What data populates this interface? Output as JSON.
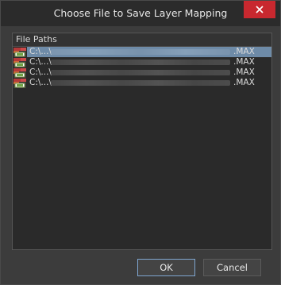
{
  "window": {
    "title": "Choose File to Save Layer Mapping"
  },
  "table": {
    "column_header": "File Paths",
    "rows": [
      {
        "prefix": "C:\\...\\",
        "ext": ".MAX",
        "selected": true
      },
      {
        "prefix": "C:\\...\\",
        "ext": ".MAX",
        "selected": false
      },
      {
        "prefix": "C:\\...\\",
        "ext": ".MAX",
        "selected": false
      },
      {
        "prefix": "C:\\...\\",
        "ext": ".MAX",
        "selected": false
      }
    ]
  },
  "buttons": {
    "ok": "OK",
    "cancel": "Cancel"
  },
  "colors": {
    "close": "#c8282f",
    "selection": "#6e8ba8",
    "ok_border": "#7fa6d0"
  }
}
